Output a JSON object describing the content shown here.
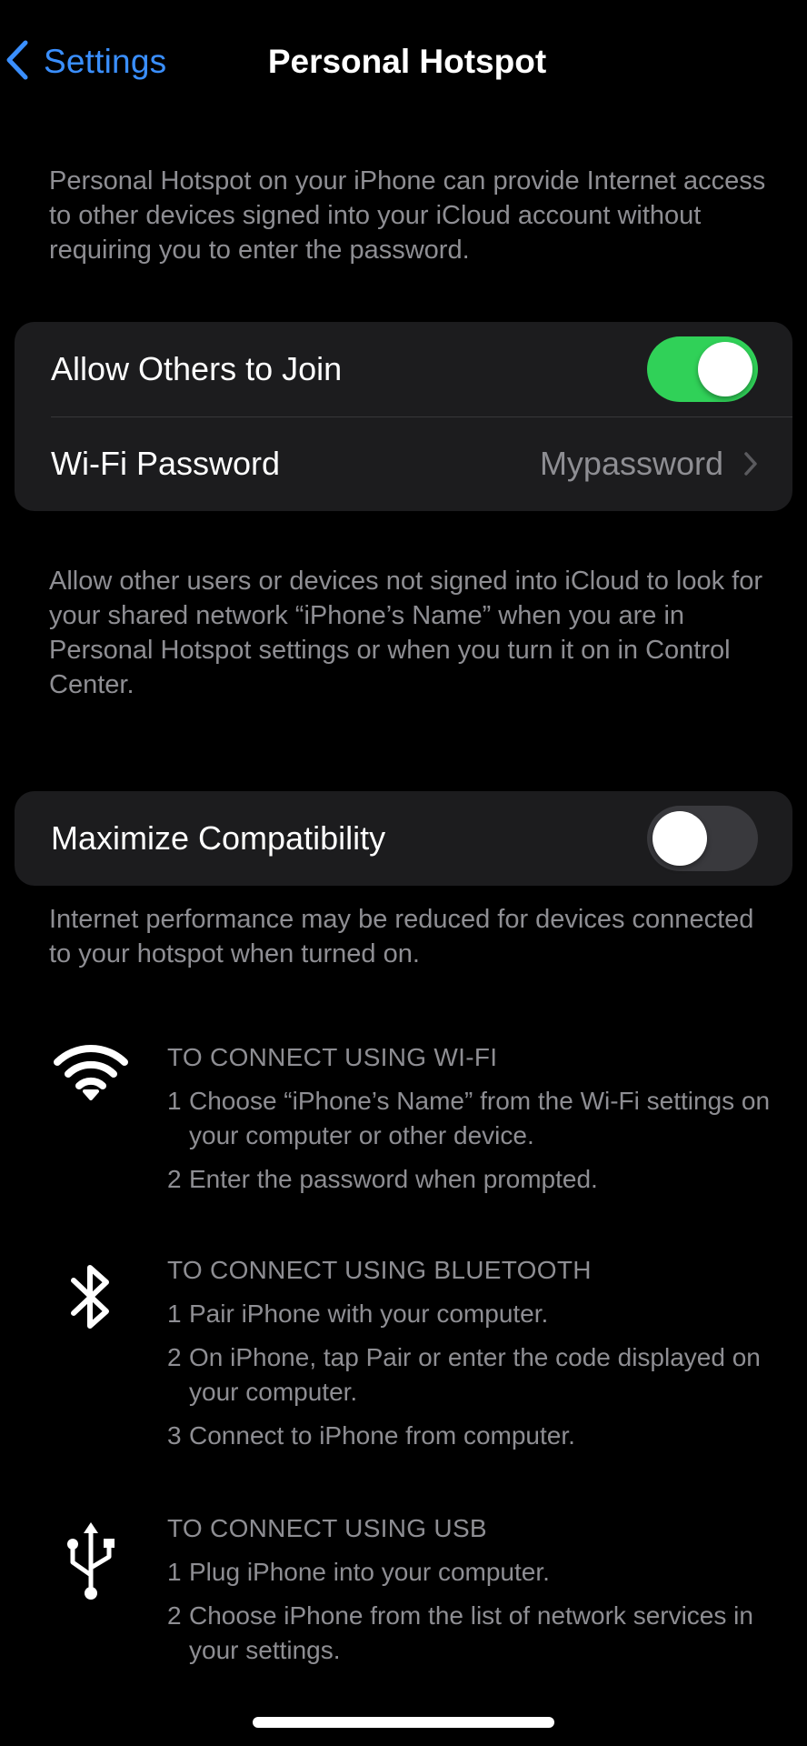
{
  "nav": {
    "back_label": "Settings",
    "title": "Personal Hotspot"
  },
  "intro_note": "Personal Hotspot on your iPhone can provide Internet access to other devices signed into your iCloud account without requiring you to enter the password.",
  "group1": {
    "allow_label": "Allow Others to Join",
    "allow_on": true,
    "wifi_label": "Wi-Fi Password",
    "wifi_value": "Mypassword"
  },
  "allow_note": "Allow other users or devices not signed into iCloud to look for your shared network “iPhone’s Name” when you are in Personal Hotspot settings or when you turn it on in Control Center.",
  "group2": {
    "maximize_label": "Maximize Compatibility",
    "maximize_on": false
  },
  "maximize_note": "Internet performance may be reduced for devices connected to your hotspot when turned on.",
  "instructions": {
    "wifi": {
      "icon": "wifi-icon",
      "heading": "TO CONNECT USING WI-FI",
      "steps": [
        {
          "num": "1",
          "text": "Choose “iPhone’s Name” from the Wi-Fi settings on your computer or other device."
        },
        {
          "num": "2",
          "text": "Enter the password when prompted."
        }
      ]
    },
    "bluetooth": {
      "icon": "bluetooth-icon",
      "heading": "TO CONNECT USING BLUETOOTH",
      "steps": [
        {
          "num": "1",
          "text": "Pair iPhone with your computer."
        },
        {
          "num": "2",
          "text": "On iPhone, tap Pair or enter the code displayed on your computer."
        },
        {
          "num": "3",
          "text": "Connect to iPhone from computer."
        }
      ]
    },
    "usb": {
      "icon": "usb-icon",
      "heading": "TO CONNECT USING USB",
      "steps": [
        {
          "num": "1",
          "text": "Plug iPhone into your computer."
        },
        {
          "num": "2",
          "text": "Choose iPhone from the list of network services in your settings."
        }
      ]
    }
  },
  "colors": {
    "background": "#000000",
    "cell": "#1c1c1e",
    "accent": "#3a8fff",
    "toggle_on": "#30d158",
    "toggle_off": "#39393d",
    "secondary_text": "#8e8e93"
  }
}
